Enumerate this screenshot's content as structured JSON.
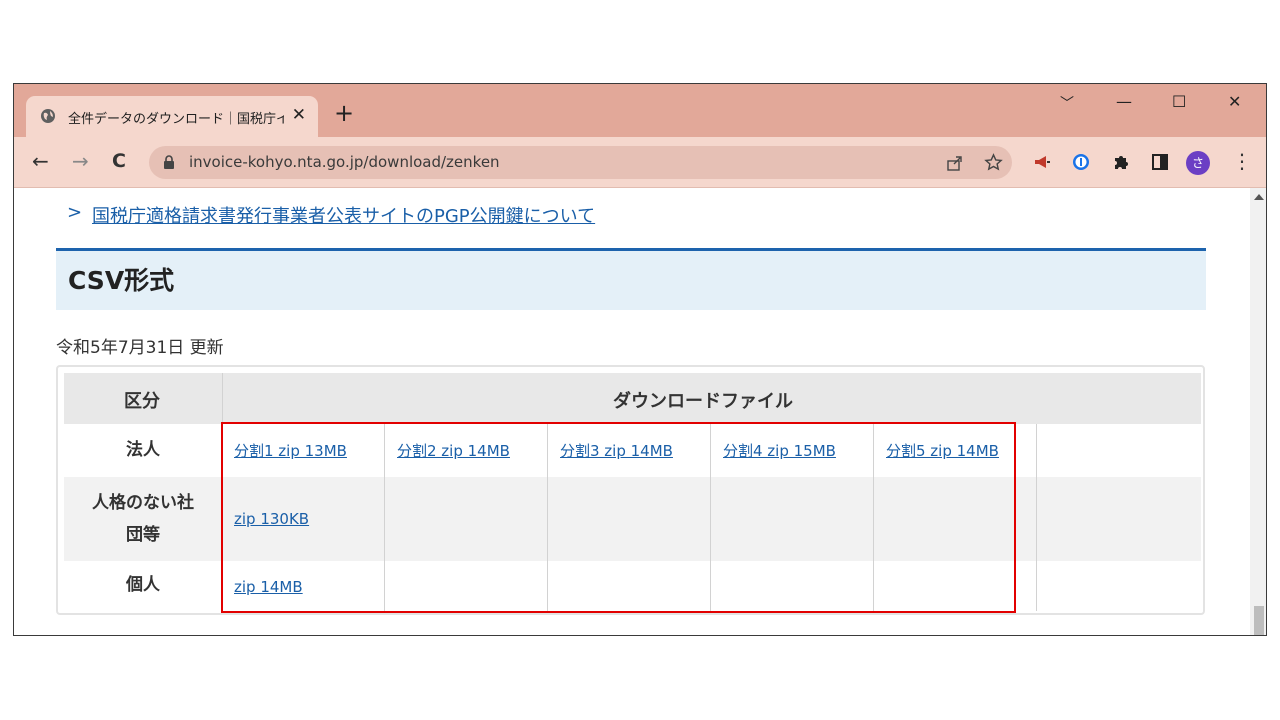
{
  "tab": {
    "title": "全件データのダウンロード｜国税庁イン",
    "close": "✕",
    "new_tab": "+"
  },
  "window": {
    "dropdown": "﹀",
    "minimize": "—",
    "maximize": "☐",
    "close": "✕"
  },
  "toolbar": {
    "back": "←",
    "forward": "→",
    "reload": "C",
    "url": "invoice-kohyo.nta.go.jp/download/zenken",
    "profile_initial": "さ",
    "menu": "⋮"
  },
  "page": {
    "pgp_chevron": ">",
    "pgp_link": "国税庁適格請求書発行事業者公表サイトのPGP公開鍵について",
    "section_title": "CSV形式",
    "updated": "令和5年7月31日 更新",
    "table": {
      "header_category": "区分",
      "header_download": "ダウンロードファイル",
      "rows": [
        {
          "label": "法人",
          "links": [
            "分割1 zip 13MB",
            "分割2 zip 14MB",
            "分割3 zip 14MB",
            "分割4 zip 15MB",
            "分割5 zip 14MB"
          ]
        },
        {
          "label_line1": "人格のない社",
          "label_line2": "団等",
          "links": [
            "zip 130KB"
          ]
        },
        {
          "label": "個人",
          "links": [
            "zip 14MB"
          ]
        }
      ]
    }
  },
  "colors": {
    "titlebar": "#e2a899",
    "toolbar": "#f5d7cd",
    "link": "#1a5fa8",
    "section_border": "#1d63ad",
    "section_bg": "#e4f0f8",
    "highlight": "#e20000",
    "profile": "#6b3fc4"
  }
}
